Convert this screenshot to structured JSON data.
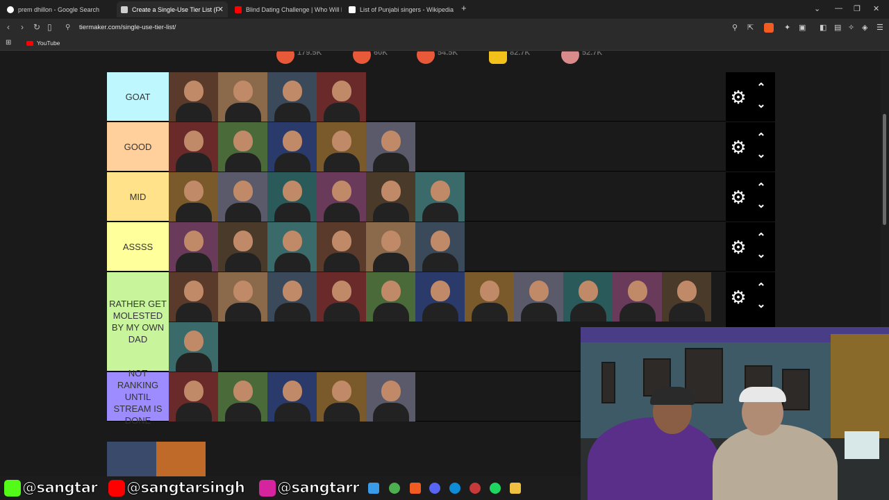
{
  "browser": {
    "tabs": [
      {
        "title": "prem dhillon - Google Search",
        "color": "#4285f4"
      },
      {
        "title": "Create a Single-Use Tier List (Pri",
        "color": "#e0e0e0"
      },
      {
        "title": "Blind Dating Challenge | Who Will Ki",
        "color": "#ff0000"
      },
      {
        "title": "List of Punjabi singers - Wikipedia",
        "color": "#ffffff"
      }
    ],
    "url": "tiermaker.com/single-use-tier-list/",
    "bookmark": "YouTube",
    "tab_close": "✕",
    "new_tab": "+"
  },
  "reactions": [
    {
      "count": "179.5K",
      "color": "#e8593a"
    },
    {
      "count": "60K",
      "color": "#e8593a"
    },
    {
      "count": "54.5K",
      "color": "#e8593a"
    },
    {
      "count": "82.7K",
      "color": "#f2c21a"
    },
    {
      "count": "52.7K",
      "color": "#d98a8a"
    }
  ],
  "tiers": [
    {
      "label": "GOAT",
      "color": "#bff7ff",
      "count": 4,
      "rows": 1
    },
    {
      "label": "GOOD",
      "color": "#ffd09c",
      "count": 5,
      "rows": 1
    },
    {
      "label": "MID",
      "color": "#ffe28a",
      "count": 6,
      "rows": 1
    },
    {
      "label": "ASSSS",
      "color": "#ffff9c",
      "count": 6,
      "rows": 1
    },
    {
      "label": "RATHER GET MOLESTED BY MY OWN DAD",
      "color": "#c8f59c",
      "count": 12,
      "rows": 2
    },
    {
      "label": "NOT RANKING UNTIL STREAM IS DONE",
      "color": "#9c8cff",
      "count": 5,
      "rows": 1
    }
  ],
  "icons": {
    "gear": "⚙",
    "up": "⌃",
    "down": "⌄"
  },
  "social": {
    "kick": "@sangtar",
    "youtube": "@sangtarsingh",
    "instagram": "@sangtarr"
  }
}
